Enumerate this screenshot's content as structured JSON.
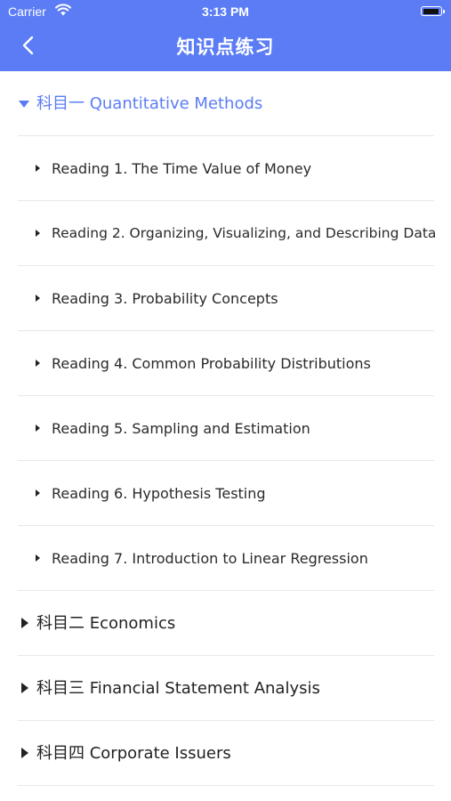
{
  "status_bar": {
    "carrier": "Carrier",
    "time": "3:13 PM",
    "icons": [
      "wifi-icon",
      "battery-icon"
    ]
  },
  "nav": {
    "title": "知识点练习",
    "back_icon": "chevron-left-icon"
  },
  "colors": {
    "accent": "#5b7cf5",
    "text": "#222222",
    "separator": "#e8e8e8"
  },
  "subjects": [
    {
      "label": "科目一 Quantitative Methods",
      "expanded": true,
      "readings": [
        "Reading 1. The Time Value of Money",
        "Reading 2. Organizing, Visualizing,  and Describing Data",
        "Reading 3. Probability Concepts",
        "Reading 4. Common Probability Distributions",
        "Reading 5. Sampling and Estimation",
        "Reading 6. Hypothesis Testing",
        "Reading 7. Introduction to Linear Regression"
      ]
    },
    {
      "label": "科目二 Economics",
      "expanded": false
    },
    {
      "label": "科目三 Financial Statement Analysis",
      "expanded": false
    },
    {
      "label": "科目四 Corporate Issuers",
      "expanded": false
    }
  ]
}
